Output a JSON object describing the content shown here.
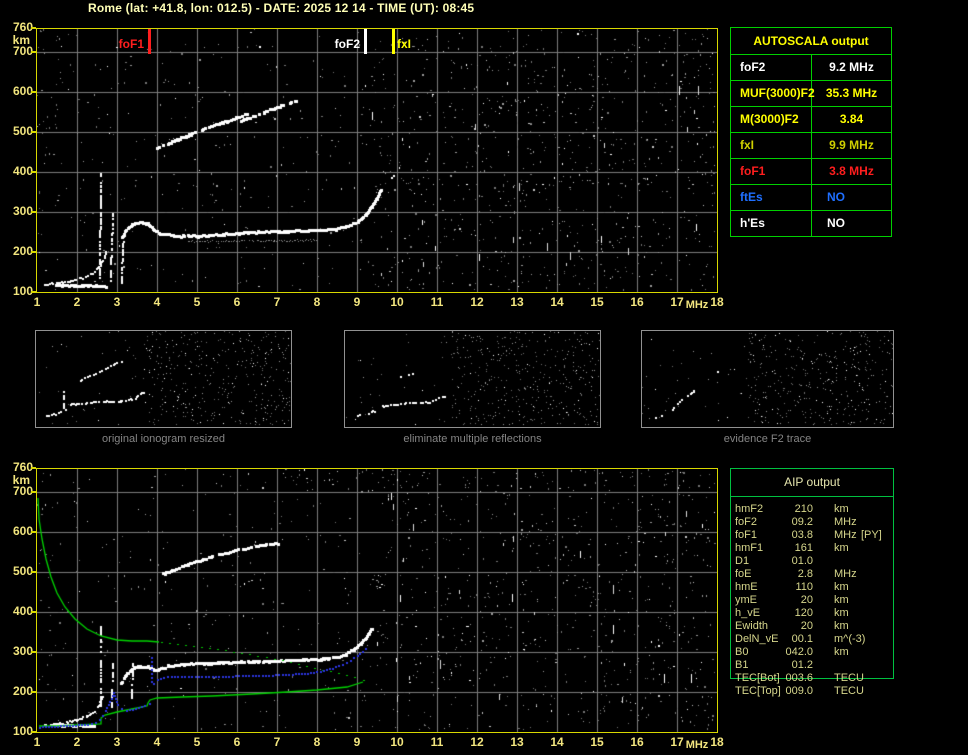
{
  "title": "Rome (lat: +41.8, lon: 012.5) - DATE: 2025 12 14 - TIME (UT): 08:45",
  "colors": {
    "background": "#000000",
    "title_text": "#ffffb6",
    "axis_text": "#f2e57e",
    "plot_border": "#d8d800",
    "grid": "#7d7d7d",
    "trace_white": "#ffffff",
    "table_border_green": "#00d000",
    "profile_green": "#00d400",
    "trace_blue": "#2b35e0",
    "marker_red": "#ff1e1e",
    "marker_white": "#ffffff",
    "marker_yellow": "#ffff00",
    "caption_gray": "#858585"
  },
  "top_plot": {
    "y_unit": "km",
    "y_ticks": [
      "760",
      "700",
      "600",
      "500",
      "400",
      "300",
      "200",
      "100"
    ],
    "x_ticks": [
      "1",
      "2",
      "3",
      "4",
      "5",
      "6",
      "7",
      "8",
      "9",
      "10",
      "11",
      "12",
      "13",
      "14",
      "15",
      "16",
      "17",
      "18"
    ],
    "x_unit": "MHz",
    "markers": [
      {
        "label": "foF1",
        "freq_mhz": 3.8,
        "color": "#ff1e1e",
        "side": "left"
      },
      {
        "label": "foF2",
        "freq_mhz": 9.2,
        "color": "#ffffff",
        "side": "left"
      },
      {
        "label": "fxI",
        "freq_mhz": 9.9,
        "color": "#ffff00",
        "side": "right"
      }
    ]
  },
  "autoscala_table": {
    "header": "AUTOSCALA output",
    "rows": [
      {
        "label": "foF2",
        "value": "9.2 MHz",
        "color": "#ffffff"
      },
      {
        "label": "MUF(3000)F2",
        "value": "35.3 MHz",
        "color": "#ffff00"
      },
      {
        "label": "M(3000)F2",
        "value": "3.84",
        "color": "#ffff00"
      },
      {
        "label": "fxI",
        "value": "9.9 MHz",
        "color": "#cfcf00"
      },
      {
        "label": "foF1",
        "value": "3.8 MHz",
        "color": "#ff1e1e"
      },
      {
        "label": "ftEs",
        "value": "NO",
        "color": "#1f6fff"
      },
      {
        "label": "h'Es",
        "value": "NO",
        "color": "#ffffff"
      }
    ]
  },
  "thumbnails": [
    {
      "caption": "original ionogram resized"
    },
    {
      "caption": "eliminate multiple reflections"
    },
    {
      "caption": "evidence F2 trace"
    }
  ],
  "bottom_plot": {
    "y_unit": "km",
    "y_ticks": [
      "760",
      "700",
      "600",
      "500",
      "400",
      "300",
      "200",
      "100"
    ],
    "x_ticks": [
      "1",
      "2",
      "3",
      "4",
      "5",
      "6",
      "7",
      "8",
      "9",
      "10",
      "11",
      "12",
      "13",
      "14",
      "15",
      "16",
      "17",
      "18"
    ],
    "x_unit": "MHz"
  },
  "aip_table": {
    "header": "AIP output",
    "rows": [
      {
        "label": "hmF2",
        "value": "210",
        "unit": "km",
        "note": ""
      },
      {
        "label": "foF2",
        "value": "09.2",
        "unit": "MHz",
        "note": ""
      },
      {
        "label": "foF1",
        "value": "03.8",
        "unit": "MHz",
        "note": "[PY]"
      },
      {
        "label": "hmF1",
        "value": "161",
        "unit": "km",
        "note": ""
      },
      {
        "label": "D1",
        "value": "01.0",
        "unit": "",
        "note": ""
      },
      {
        "label": "foE",
        "value": "2.8",
        "unit": "MHz",
        "note": ""
      },
      {
        "label": "hmE",
        "value": "110",
        "unit": "km",
        "note": ""
      },
      {
        "label": "ymE",
        "value": "20",
        "unit": "km",
        "note": ""
      },
      {
        "label": "h_vE",
        "value": "120",
        "unit": "km",
        "note": ""
      },
      {
        "label": "Ewidth",
        "value": "20",
        "unit": "km",
        "note": ""
      },
      {
        "label": "DelN_vE",
        "value": "00.1",
        "unit": "m^(-3)",
        "note": ""
      },
      {
        "label": "B0",
        "value": "042.0",
        "unit": "km",
        "note": ""
      },
      {
        "label": "B1",
        "value": "01.2",
        "unit": "",
        "note": ""
      },
      {
        "label": "TEC[Bot]",
        "value": "003.6",
        "unit": "TECU",
        "note": ""
      },
      {
        "label": "TEC[Top]",
        "value": "009.0",
        "unit": "TECU",
        "note": ""
      }
    ]
  }
}
